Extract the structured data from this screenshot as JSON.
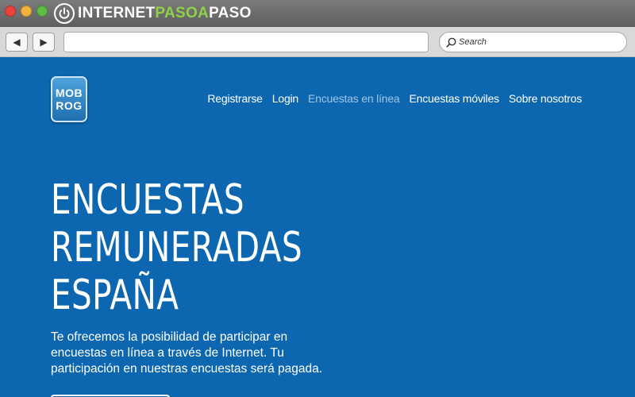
{
  "browser": {
    "brand": {
      "part1": "INTERNET",
      "part2": "PASOA",
      "part3": "PASO"
    },
    "toolbar": {
      "back_icon": "back-arrow-icon",
      "forward_icon": "forward-arrow-icon",
      "address_value": "",
      "search_placeholder": "Search"
    }
  },
  "site": {
    "logo": {
      "line1": "MOB",
      "line2": "ROG"
    },
    "nav": [
      {
        "label": "Registrarse"
      },
      {
        "label": "Login"
      },
      {
        "label": "Encuestas en línea"
      },
      {
        "label": "Encuestas móviles"
      },
      {
        "label": "Sobre nosotros"
      }
    ],
    "hero": {
      "title_lines": [
        "ENCUESTAS",
        "REMUNERADAS",
        "ESPAÑA"
      ],
      "description": "Te ofrecemos la posibilidad de participar en encuestas en línea a través de Internet. Tu participación en nuestras encuestas será pagada."
    }
  },
  "colors": {
    "page_background": "#0d67b0",
    "nav_active": "#9fc4e4",
    "brand_green": "#8fd147"
  }
}
